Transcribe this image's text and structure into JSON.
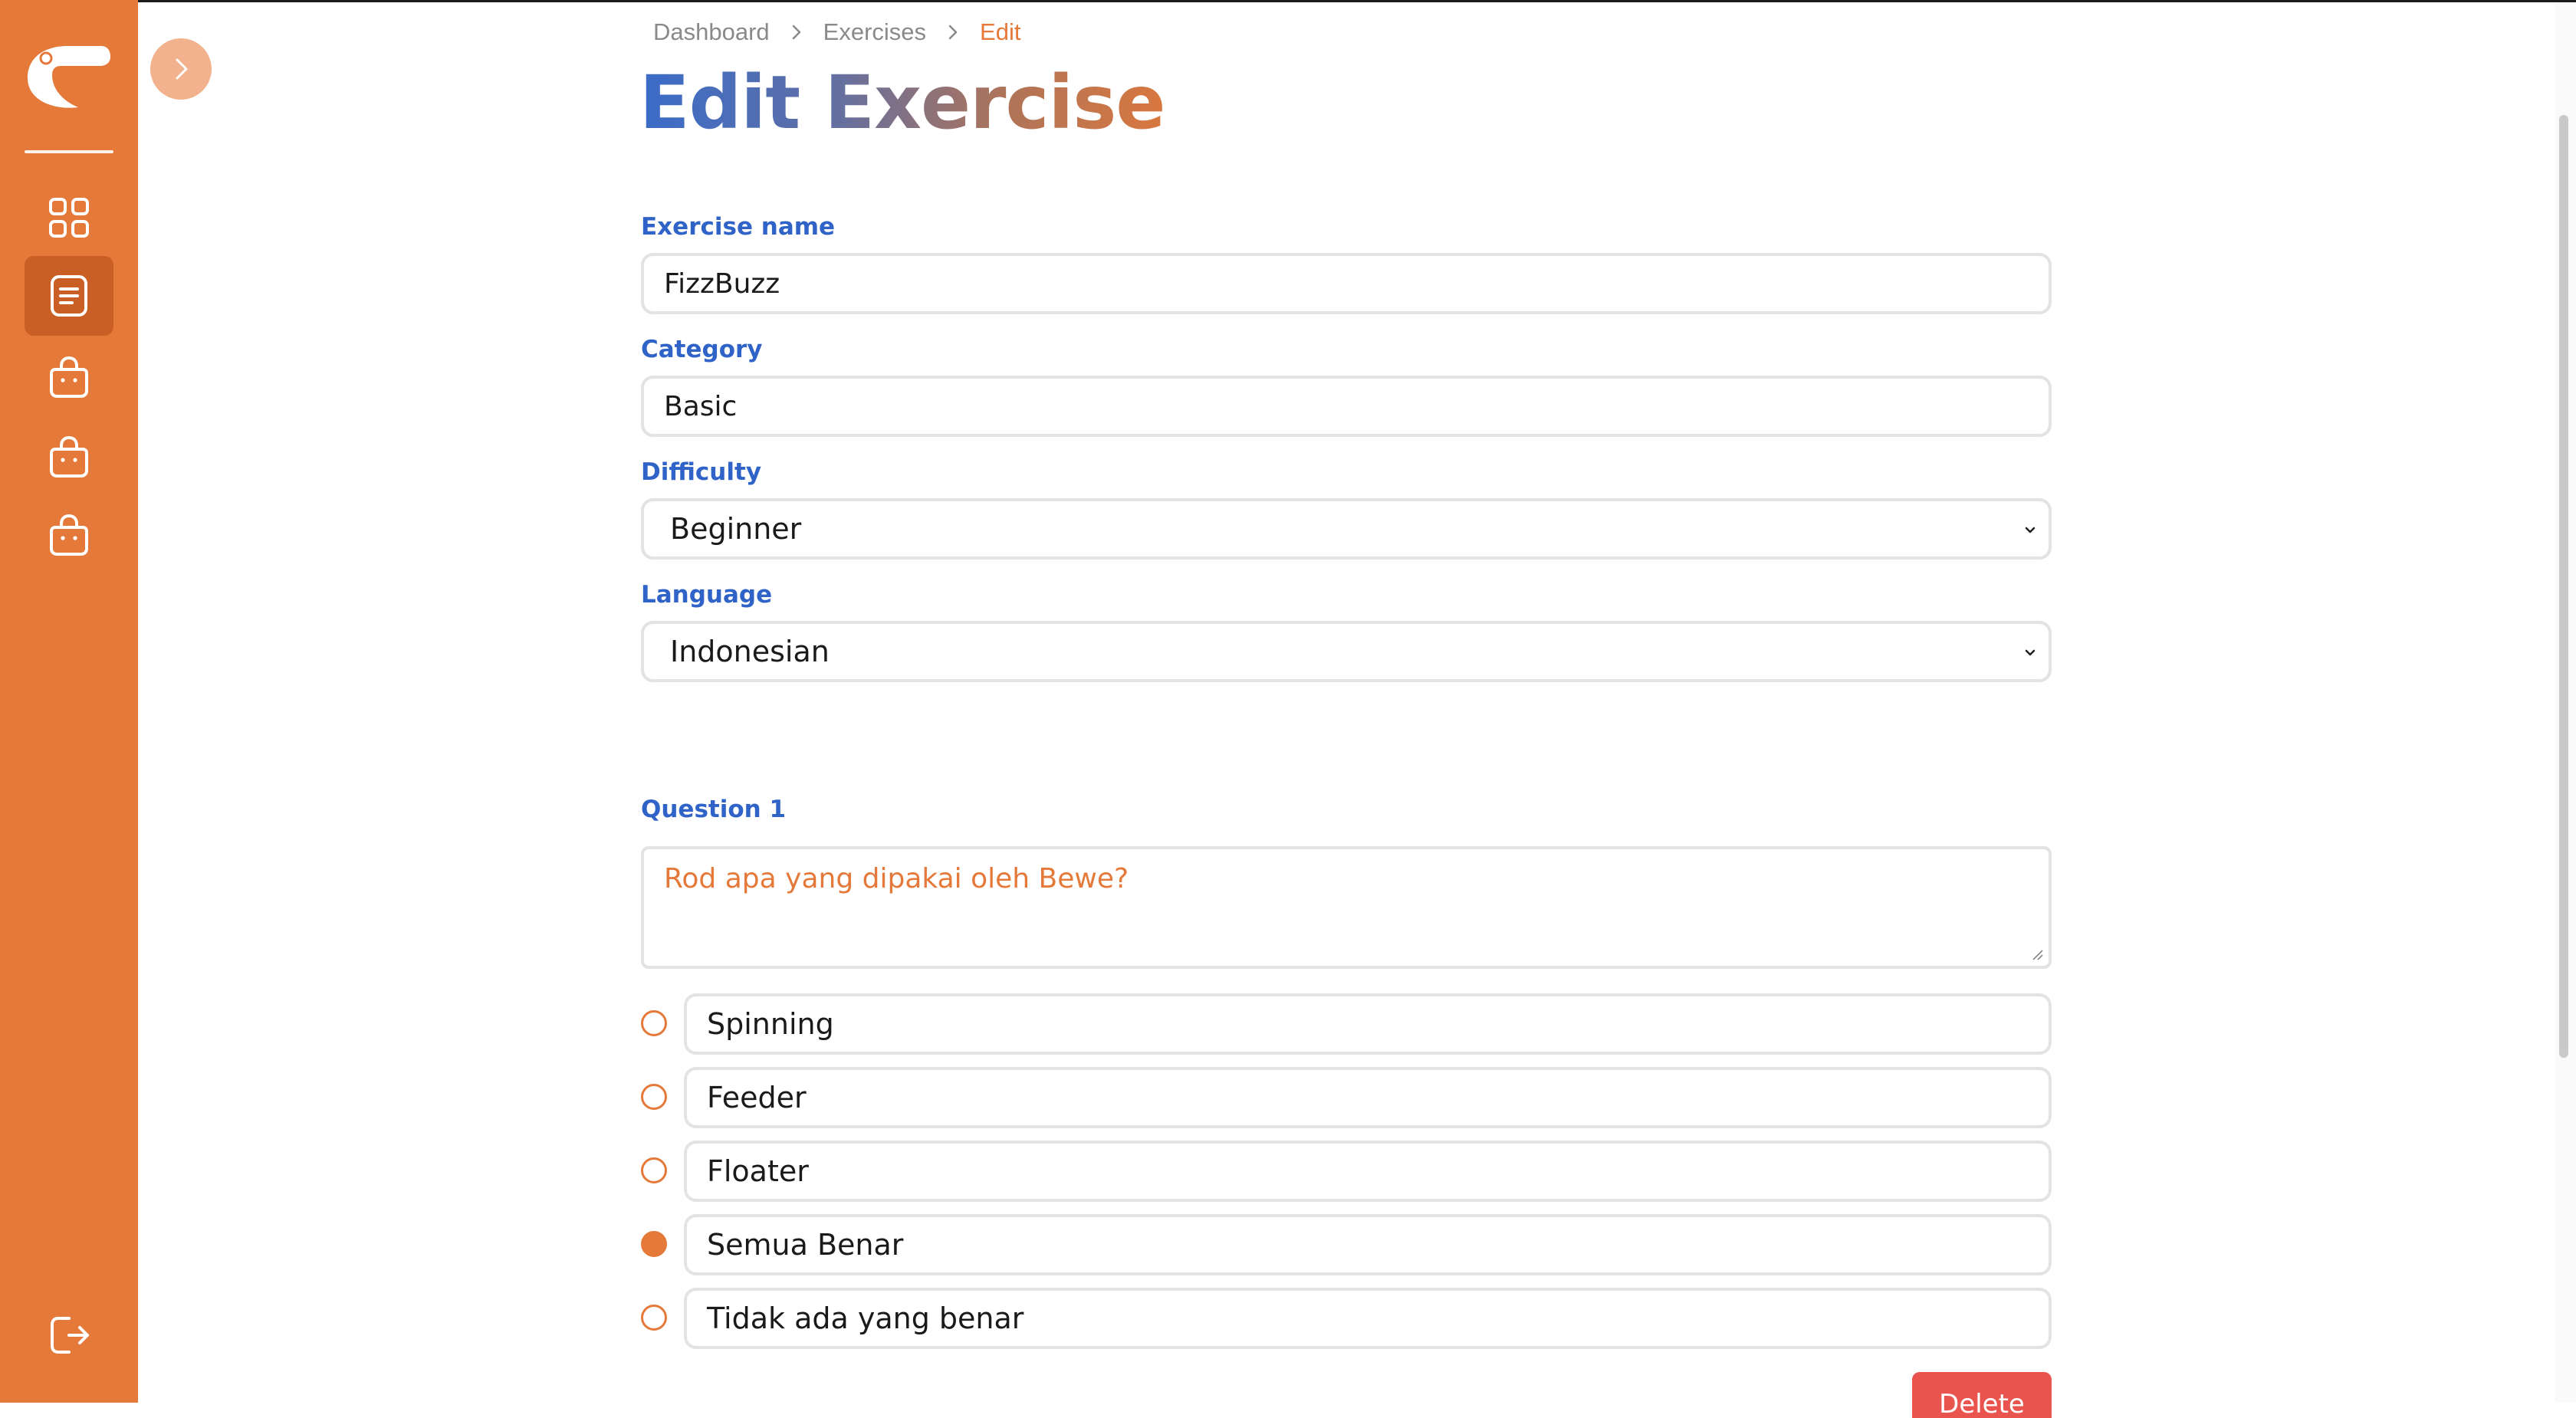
{
  "breadcrumb": {
    "items": [
      "Dashboard",
      "Exercises",
      "Edit"
    ]
  },
  "page": {
    "title_part1": "Edit",
    "title_part2": "Exercise"
  },
  "form": {
    "exercise_name": {
      "label": "Exercise name",
      "value": "FizzBuzz"
    },
    "category": {
      "label": "Category",
      "value": "Basic"
    },
    "difficulty": {
      "label": "Difficulty",
      "value": "Beginner"
    },
    "language": {
      "label": "Language",
      "value": "Indonesian"
    }
  },
  "questions": [
    {
      "label": "Question 1",
      "text": "Rod apa yang dipakai oleh Bewe?",
      "answers": [
        {
          "text": "Spinning",
          "correct": false
        },
        {
          "text": "Feeder",
          "correct": false
        },
        {
          "text": "Floater",
          "correct": false
        },
        {
          "text": "Semua Benar",
          "correct": true
        },
        {
          "text": "Tidak ada yang benar",
          "correct": false
        }
      ]
    }
  ],
  "actions": {
    "delete_label": "Delete"
  },
  "sidebar": {
    "items": [
      {
        "icon": "dashboard-grid-icon",
        "active": false
      },
      {
        "icon": "exercises-list-icon",
        "active": true
      },
      {
        "icon": "shopping-bag-icon",
        "active": false
      },
      {
        "icon": "shopping-bag-icon",
        "active": false
      },
      {
        "icon": "shopping-bag-icon",
        "active": false
      }
    ],
    "logout_icon": "logout-icon"
  },
  "colors": {
    "accent": "#E5793A",
    "label_blue": "#2F63C7",
    "danger": "#E9554E"
  }
}
